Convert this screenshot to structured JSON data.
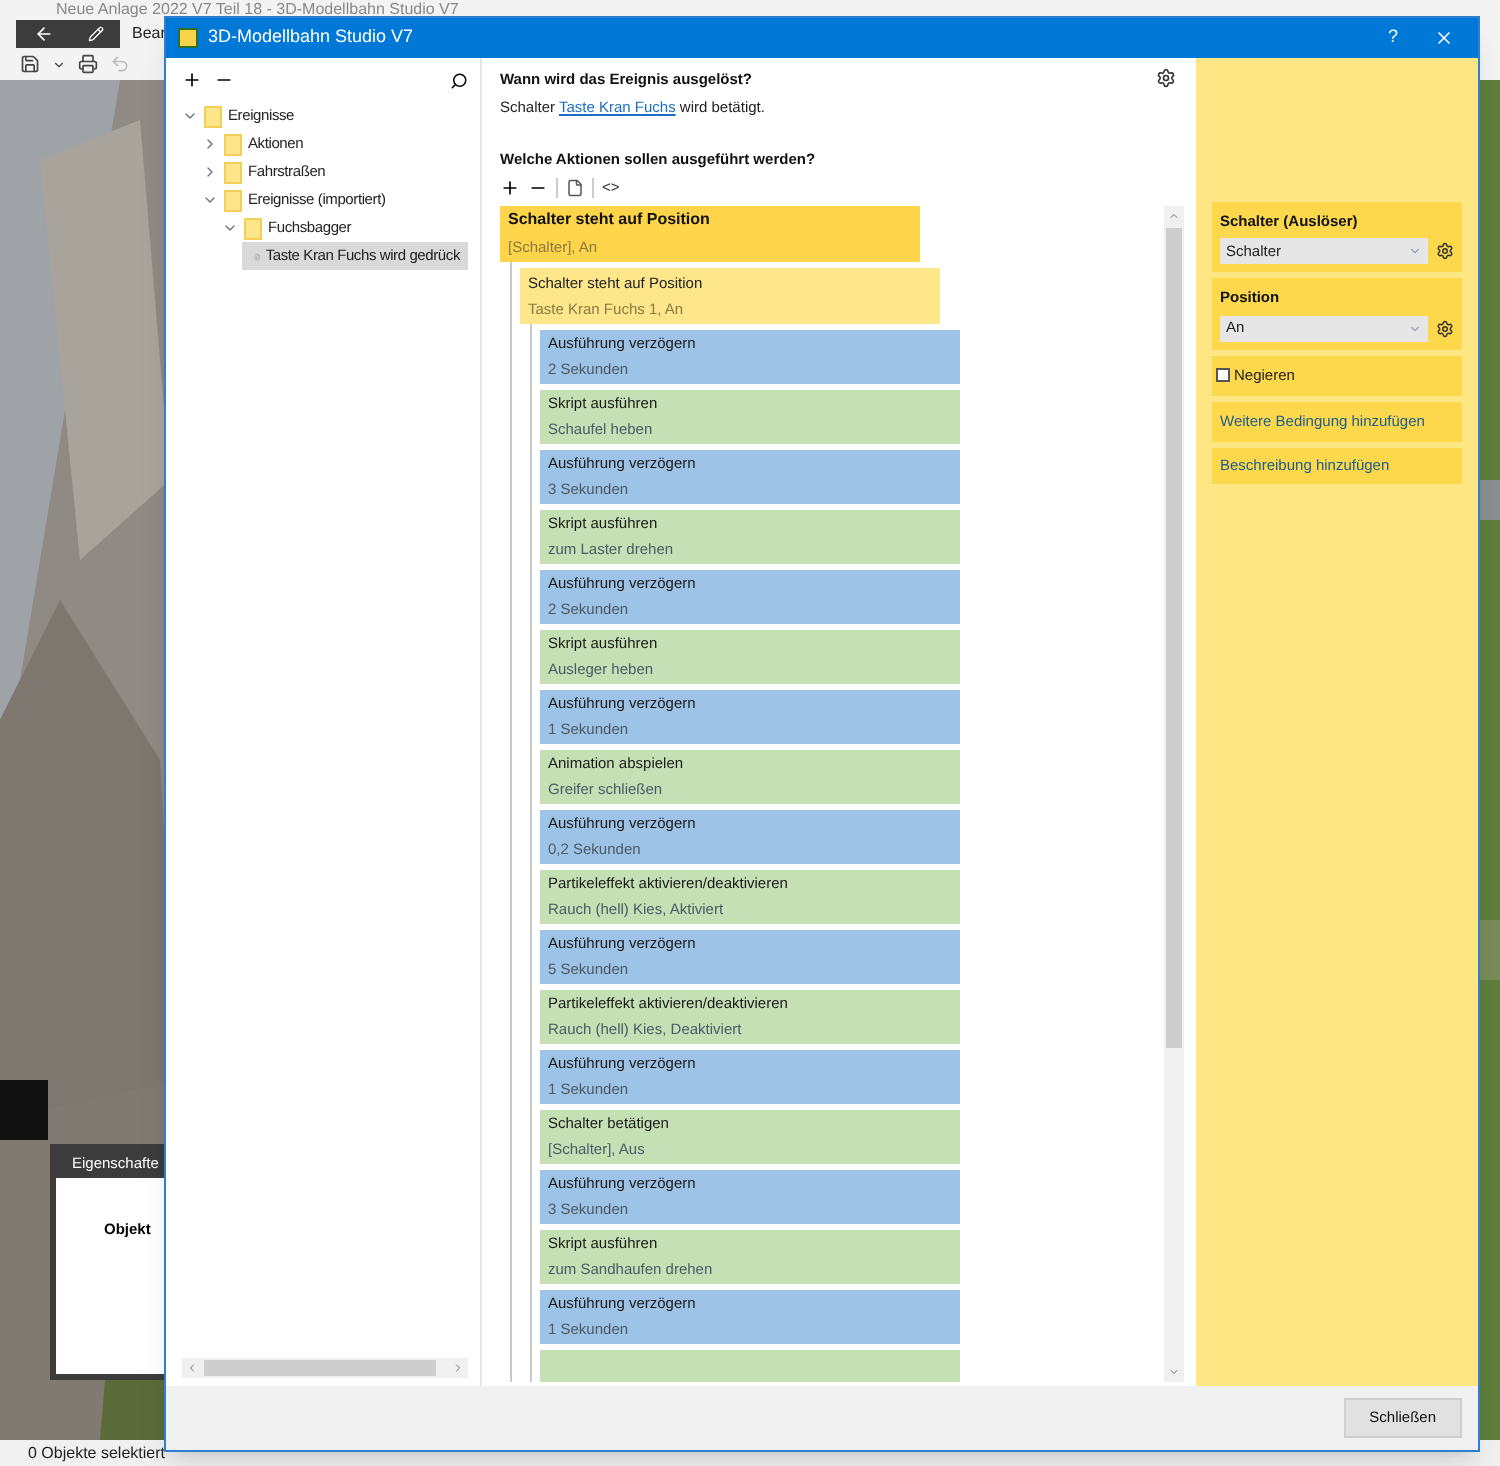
{
  "app": {
    "title": "Neue Anlage 2022 V7 Teil 18 - 3D-Modellbahn Studio V7",
    "toolbar_label": "Bear",
    "properties_panel": {
      "title": "Eigenschafte",
      "label": "Objekt"
    },
    "status_bar": "0 Objekte selektiert"
  },
  "dialog": {
    "title": "3D-Modellbahn Studio V7",
    "help": "?",
    "tree": [
      {
        "label": "Ereignisse",
        "kind": "folder",
        "expanded": true,
        "selected": false,
        "children": [
          {
            "label": "Aktionen",
            "kind": "folder",
            "expanded": false,
            "selected": false
          },
          {
            "label": "Fahrstraßen",
            "kind": "folder",
            "expanded": false,
            "selected": false
          },
          {
            "label": "Ereignisse (importiert)",
            "kind": "folder",
            "expanded": true,
            "selected": false,
            "children": [
              {
                "label": "Fuchsbagger",
                "kind": "folder",
                "expanded": true,
                "selected": false,
                "children": [
                  {
                    "label": "Taste Kran Fuchs wird gedrück",
                    "kind": "file",
                    "selected": true
                  }
                ]
              }
            ]
          }
        ]
      }
    ],
    "trigger": {
      "question": "Wann wird das Ereignis ausgelöst?",
      "text_before": "Schalter",
      "link": "Taste Kran Fuchs",
      "text_after": "wird betätigt."
    },
    "actions_heading": "Welche Aktionen sollen ausgeführt werden?",
    "code_toggle": "<>",
    "condition": {
      "title": "Schalter steht auf Position",
      "detail": "[Schalter], An"
    },
    "sub_condition": {
      "title": "Schalter steht auf Position",
      "detail": "Taste Kran Fuchs 1, An"
    },
    "actions": [
      {
        "kind": "delay",
        "title": "Ausführung verzögern",
        "detail": "2 Sekunden"
      },
      {
        "kind": "action",
        "title": "Skript ausführen",
        "detail": "Schaufel heben"
      },
      {
        "kind": "delay",
        "title": "Ausführung verzögern",
        "detail": "3 Sekunden"
      },
      {
        "kind": "action",
        "title": "Skript ausführen",
        "detail": "zum Laster drehen"
      },
      {
        "kind": "delay",
        "title": "Ausführung verzögern",
        "detail": "2 Sekunden"
      },
      {
        "kind": "action",
        "title": "Skript ausführen",
        "detail": "Ausleger heben"
      },
      {
        "kind": "delay",
        "title": "Ausführung verzögern",
        "detail": "1 Sekunden"
      },
      {
        "kind": "action",
        "title": "Animation abspielen",
        "detail": "Greifer schließen"
      },
      {
        "kind": "delay",
        "title": "Ausführung verzögern",
        "detail": "0,2 Sekunden"
      },
      {
        "kind": "action",
        "title": "Partikeleffekt aktivieren/deaktivieren",
        "detail": "Rauch (hell) Kies, Aktiviert"
      },
      {
        "kind": "delay",
        "title": "Ausführung verzögern",
        "detail": "5 Sekunden"
      },
      {
        "kind": "action",
        "title": "Partikeleffekt aktivieren/deaktivieren",
        "detail": "Rauch (hell) Kies, Deaktiviert"
      },
      {
        "kind": "delay",
        "title": "Ausführung verzögern",
        "detail": "1 Sekunden"
      },
      {
        "kind": "action",
        "title": "Schalter betätigen",
        "detail": "[Schalter], Aus"
      },
      {
        "kind": "delay",
        "title": "Ausführung verzögern",
        "detail": "3 Sekunden"
      },
      {
        "kind": "action",
        "title": "Skript ausführen",
        "detail": "zum Sandhaufen drehen"
      },
      {
        "kind": "delay",
        "title": "Ausführung verzögern",
        "detail": "1 Sekunden"
      },
      {
        "kind": "action"
      }
    ],
    "properties": {
      "trigger_label": "Schalter (Auslöser)",
      "trigger_value": "Schalter",
      "position_label": "Position",
      "position_value": "An",
      "negate_label": "Negieren",
      "negate_checked": false,
      "add_condition": "Weitere Bedingung hinzufügen",
      "add_description": "Beschreibung hinzufügen"
    },
    "close_button": "Schließen"
  }
}
